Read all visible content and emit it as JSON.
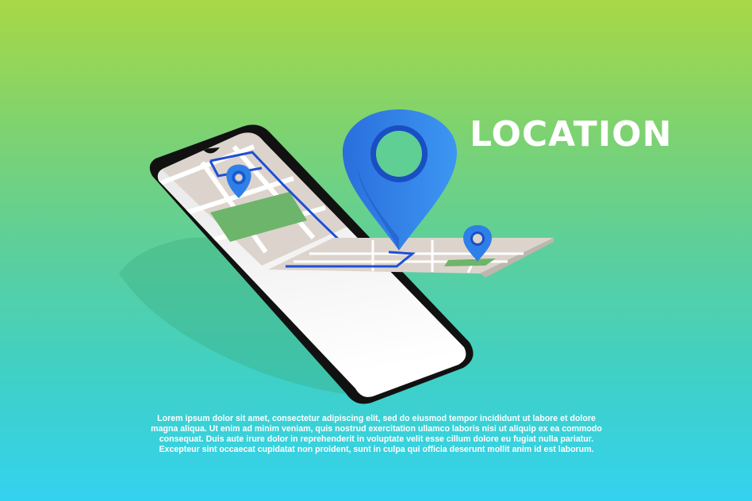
{
  "title": "LOCATION",
  "body_text": "Lorem ipsum dolor sit amet, consectetur adipiscing elit, sed do eiusmod tempor incididunt ut labore et dolore magna aliqua. Ut enim ad minim veniam, quis nostrud exercitation ullamco laboris nisi ut aliquip ex ea commodo consequat. Duis aute irure dolor in reprehenderit in voluptate velit esse cillum dolore eu fugiat nulla pariatur. Excepteur sint occaecat cupidatat non proident, sunt in culpa qui officia deserunt mollit anim id est laborum.",
  "colors": {
    "gradient_top": "#a8d846",
    "gradient_bottom": "#33d2ef",
    "pin_blue": "#2f7fe8",
    "route_blue": "#1f4fd6",
    "map_beige": "#dcd4cc",
    "park_green": "#6db56a",
    "phone_body": "#111111"
  },
  "icons": [
    "smartphone-illustration",
    "large-location-pin-icon",
    "small-location-pin-icon",
    "map-pin-on-phone-icon"
  ]
}
